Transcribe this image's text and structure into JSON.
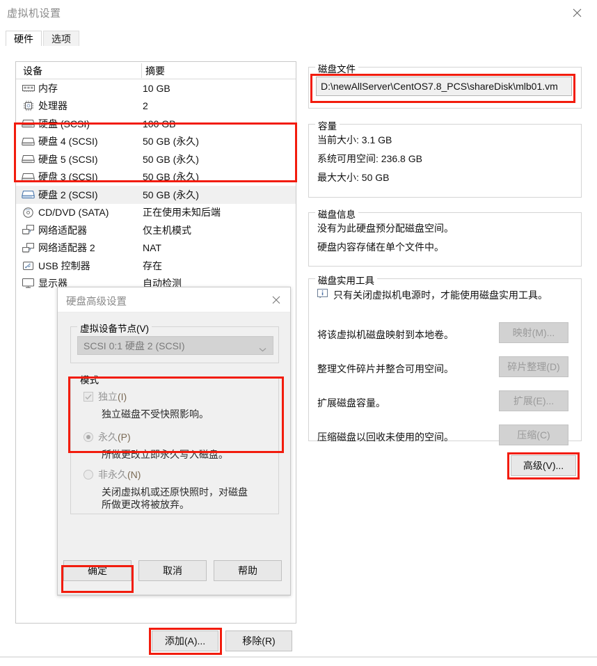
{
  "window": {
    "title": "虚拟机设置",
    "close_icon": "close-icon"
  },
  "tabs": [
    {
      "label": "硬件",
      "active": true
    },
    {
      "label": "选项",
      "active": false
    }
  ],
  "device_list": {
    "headers": {
      "device": "设备",
      "summary": "摘要"
    },
    "rows": [
      {
        "icon": "memory-icon",
        "name": "内存",
        "summary": "10 GB",
        "selected": false
      },
      {
        "icon": "cpu-icon",
        "name": "处理器",
        "summary": "2",
        "selected": false
      },
      {
        "icon": "disk-icon",
        "name": "硬盘 (SCSI)",
        "summary": "100 GB",
        "selected": false
      },
      {
        "icon": "disk-icon",
        "name": "硬盘 4 (SCSI)",
        "summary": "50 GB (永久)",
        "selected": false
      },
      {
        "icon": "disk-icon",
        "name": "硬盘 5 (SCSI)",
        "summary": "50 GB (永久)",
        "selected": false
      },
      {
        "icon": "disk-icon",
        "name": "硬盘 3 (SCSI)",
        "summary": "50 GB (永久)",
        "selected": false
      },
      {
        "icon": "disk-icon",
        "name": "硬盘 2 (SCSI)",
        "summary": "50 GB (永久)",
        "selected": true
      },
      {
        "icon": "cddvd-icon",
        "name": "CD/DVD (SATA)",
        "summary": "正在使用未知后端",
        "selected": false
      },
      {
        "icon": "network-icon",
        "name": "网络适配器",
        "summary": "仅主机模式",
        "selected": false
      },
      {
        "icon": "network-icon",
        "name": "网络适配器 2",
        "summary": "NAT",
        "selected": false
      },
      {
        "icon": "usb-icon",
        "name": "USB 控制器",
        "summary": "存在",
        "selected": false
      },
      {
        "icon": "display-icon",
        "name": "显示器",
        "summary": "自动检测",
        "selected": false
      }
    ]
  },
  "disk_file": {
    "group_label": "磁盘文件",
    "path": "D:\\newAllServer\\CentOS7.8_PCS\\shareDisk\\mlb01.vm"
  },
  "capacity": {
    "group_label": "容量",
    "rows": [
      "当前大小: 3.1 GB",
      "系统可用空间: 236.8 GB",
      "最大大小: 50 GB"
    ]
  },
  "disk_info": {
    "group_label": "磁盘信息",
    "rows": [
      "没有为此硬盘预分配磁盘空间。",
      "硬盘内容存储在单个文件中。"
    ]
  },
  "disk_utilities": {
    "group_label": "磁盘实用工具",
    "note_icon": "info-icon",
    "note": "只有关闭虚拟机电源时，才能使用磁盘实用工具。",
    "rows": [
      {
        "text": "将该虚拟机磁盘映射到本地卷。",
        "button": "映射(M)...",
        "enabled": false
      },
      {
        "text": "整理文件碎片并整合可用空间。",
        "button": "碎片整理(D)",
        "enabled": false
      },
      {
        "text": "扩展磁盘容量。",
        "button": "扩展(E)...",
        "enabled": false
      },
      {
        "text": "压缩磁盘以回收未使用的空间。",
        "button": "压缩(C)",
        "enabled": false
      }
    ]
  },
  "buttons": {
    "advanced": "高级(V)...",
    "add": "添加(A)...",
    "remove": "移除(R)"
  },
  "modal": {
    "title": "硬盘高级设置",
    "close_icon": "close-icon",
    "node_group_label": "虚拟设备节点(V)",
    "node_value": "SCSI 0:1    硬盘 2 (SCSI)",
    "node_caret_icon": "chevron-down-icon",
    "mode_group_label": "模式",
    "independent": {
      "label_main": "独立",
      "label_mnemonic": "(I)",
      "checked": true,
      "description": "独立磁盘不受快照影响。"
    },
    "persistent": {
      "label_main": "永久",
      "label_mnemonic": "(P)",
      "selected": true,
      "description": "所做更改立即永久写入磁盘。"
    },
    "nonpersistent": {
      "label_main": "非永久",
      "label_mnemonic": "(N)",
      "selected": false,
      "description_line1": "关闭虚拟机或还原快照时，对磁盘",
      "description_line2": "所做更改将被放弃。"
    },
    "ok": "确定",
    "cancel": "取消",
    "help": "帮助"
  },
  "highlight_color": "#f21c0d"
}
